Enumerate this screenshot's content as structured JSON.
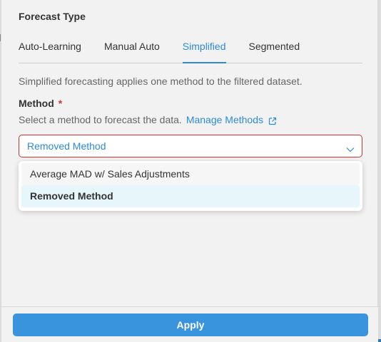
{
  "section_title": "Forecast Type",
  "tabs": [
    {
      "label": "Auto-Learning",
      "active": false
    },
    {
      "label": "Manual Auto",
      "active": false
    },
    {
      "label": "Simplified",
      "active": true
    },
    {
      "label": "Segmented",
      "active": false
    }
  ],
  "description": "Simplified forecasting applies one method to the filtered dataset.",
  "method": {
    "label": "Method",
    "required_marker": "*",
    "hint": "Select a method to forecast the data.",
    "manage_link": "Manage Methods",
    "selected_value": "Removed Method",
    "options": [
      {
        "label": "Average MAD w/ Sales Adjustments",
        "state": "hover"
      },
      {
        "label": "Removed Method",
        "state": "selected"
      }
    ]
  },
  "footer": {
    "apply_label": "Apply"
  },
  "colors": {
    "accent": "#2e8ad8",
    "error_border": "#c9352e",
    "apply_bg": "#3a93dd",
    "selected_option_bg": "#e7f6fb"
  },
  "icons": {
    "external_link": "external-link-icon",
    "chevron": "chevron-down-icon"
  }
}
